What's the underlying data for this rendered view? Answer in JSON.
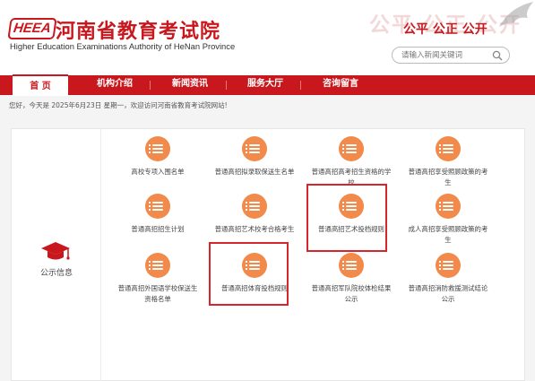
{
  "header": {
    "logo_text": "HEEA",
    "title": "河南省教育考试院",
    "subtitle": "Higher Education Examinations Authority of HeNan Province",
    "watermark": "公平 公正 公开",
    "slogan": "公平 公正 公开"
  },
  "search": {
    "placeholder": "请输入新闻关键词",
    "icon": "search-icon"
  },
  "nav": {
    "items": [
      {
        "label": "首 页",
        "active": true
      },
      {
        "label": "机构介绍",
        "active": false
      },
      {
        "label": "新闻资讯",
        "active": false
      },
      {
        "label": "服务大厅",
        "active": false
      },
      {
        "label": "咨询留言",
        "active": false
      }
    ]
  },
  "dateline": "您好，今天是 2025年6月23日 星期一，欢迎访问河南省教育考试院网站!",
  "category": {
    "label": "公示信息",
    "icon": "graduation-cap-icon"
  },
  "items": [
    {
      "label": "高校专项入围名单",
      "icon": "list-icon"
    },
    {
      "label": "普通高招拟录取保送生名单",
      "icon": "list-icon"
    },
    {
      "label": "普通高招高考招生资格的学校",
      "icon": "list-icon"
    },
    {
      "label": "普通高招享受照顾政策的考生",
      "icon": "list-icon"
    },
    {
      "label": "普通高招招生计划",
      "icon": "list-icon"
    },
    {
      "label": "普通高招艺术校考合格考生",
      "icon": "list-icon"
    },
    {
      "label": "普通高招艺术投档规则",
      "icon": "list-icon"
    },
    {
      "label": "成人高招享受照顾政策的考生",
      "icon": "list-icon"
    },
    {
      "label": "普通高招外国语学校保送生资格名单",
      "icon": "list-icon"
    },
    {
      "label": "普通高招体育投档规则",
      "icon": "list-icon"
    },
    {
      "label": "普通高招军队院校体检结果公示",
      "icon": "list-icon"
    },
    {
      "label": "普通高招消防救援测试结论公示",
      "icon": "list-icon"
    }
  ],
  "colors": {
    "brand_red": "#c8181e",
    "icon_orange": "#f18a4a",
    "highlight_red": "#d5262c"
  }
}
